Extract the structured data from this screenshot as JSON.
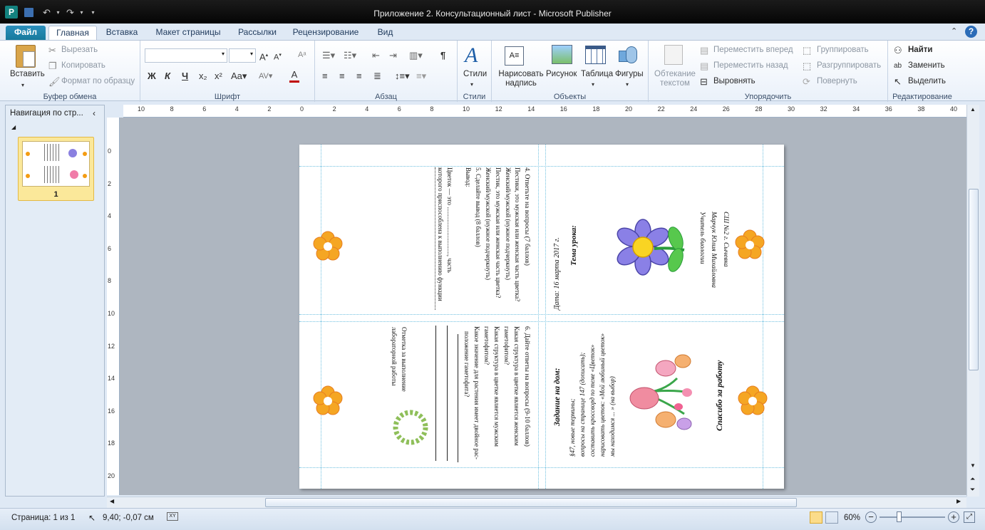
{
  "app": {
    "title": "Приложение 2. Консультационный лист  -  Microsoft Publisher",
    "logo_letter": "P"
  },
  "tabs": [
    "Файл",
    "Главная",
    "Вставка",
    "Макет страницы",
    "Рассылки",
    "Рецензирование",
    "Вид"
  ],
  "ribbon": {
    "clipboard": {
      "paste": "Вставить",
      "cut": "Вырезать",
      "copy": "Копировать",
      "format_painter": "Формат по образцу",
      "label": "Буфер обмена"
    },
    "font": {
      "label": "Шрифт",
      "bold": "Ж",
      "italic": "К",
      "underline": "Ч"
    },
    "paragraph": {
      "label": "Абзац"
    },
    "styles": {
      "button": "Стили",
      "label": "Стили"
    },
    "objects": {
      "textbox": "Нарисовать надпись",
      "picture": "Рисунок",
      "table": "Таблица",
      "shapes": "Фигуры",
      "label": "Объекты"
    },
    "arrange": {
      "wrap": "Обтекание текстом",
      "forward": "Переместить вперед",
      "backward": "Переместить назад",
      "align": "Выровнять",
      "group": "Группировать",
      "ungroup": "Разгруппировать",
      "rotate": "Повернуть",
      "label": "Упорядочить"
    },
    "editing": {
      "find": "Найти",
      "replace": "Заменить",
      "select": "Выделить",
      "label": "Редактирование"
    }
  },
  "nav": {
    "title": "Навигация по стр...",
    "page_number": "1"
  },
  "ruler": {
    "h_ticks": [
      "10",
      "8",
      "6",
      "4",
      "2",
      "0",
      "2",
      "4",
      "6",
      "8",
      "10",
      "12",
      "14",
      "16",
      "18",
      "20",
      "22",
      "24",
      "26",
      "28",
      "30",
      "32",
      "34",
      "36",
      "38",
      "40"
    ],
    "v_ticks": [
      "0",
      "2",
      "4",
      "6",
      "8",
      "10",
      "12",
      "14",
      "16",
      "18",
      "20"
    ]
  },
  "document": {
    "left_top_col1": "4. Ответьте на вопросы (7 баллов)",
    "left_top_col2": "Пестики, это мужская или женская часть цветка?",
    "left_top_col3": "Женский/мужской (нужное подчеркнуть)",
    "left_top_col4": "Пестик, это мужская или женская часть цветка?",
    "left_top_col5": "Женский/мужской (нужное подчеркнуть)",
    "left_top_col6": "5. Сделайте вывод (8 баллов)",
    "left_top_col7": "Вывод:",
    "left_top_col8": "Цветок — это .............................., часть",
    "left_top_col9": "которого приспособлена к выполнению функции",
    "date": "Дата: 16 марта 2017 г.",
    "topic": "Тема урока:",
    "teacher_role": "Учитель биологии",
    "teacher_name": "Марчук Юлия Михайловна",
    "school": "СШ №2 г. Сычевка",
    "hw_title": "Задание на дом:",
    "hw_1": "§47, новые термины;",
    "hw_2": "вопросы на странице 147 (дописать);",
    "hw_3": "составить кроссворд по теме «Цветок»",
    "hw_4": "нарисовать цветок: «Мой любимый цветок»",
    "hw_5": "мы находимся ... » (на выбор)",
    "thanks": "Спасибо за работу",
    "q6": "6. Дайте ответы на вопросы (9-10 баллов)",
    "q6a": "Какая структура в цветке является женским",
    "q6b": "гаметофитом?",
    "q6c": "Какая структура в цветке является мужским",
    "q6d": "гаметофитом?",
    "q6e": "Какое значение для растения имеет двойное рас-",
    "q6f": "положение гаметофита?",
    "grade_1": "Отметка за выполнение",
    "grade_2": "лабораторной работы"
  },
  "status": {
    "page": "Страница: 1 из 1",
    "coords": "9,40; -0,07 см",
    "zoom": "60%",
    "zoom_level": 0.6
  }
}
